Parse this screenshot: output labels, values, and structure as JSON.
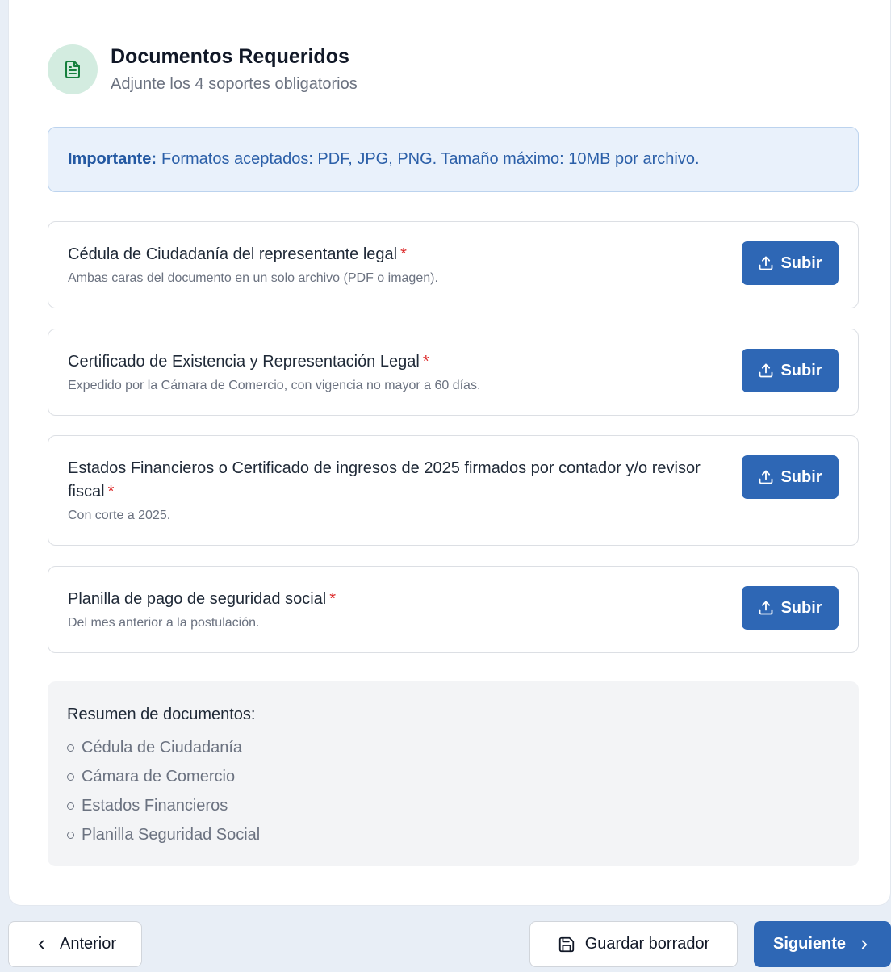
{
  "header": {
    "title": "Documentos Requeridos",
    "subtitle": "Adjunte los 4 soportes obligatorios",
    "icon": "document-icon"
  },
  "notice": {
    "label": "Importante:",
    "text": "Formatos aceptados: PDF, JPG, PNG. Tamaño máximo: 10MB por archivo."
  },
  "documents": [
    {
      "title": "Cédula de Ciudadanía del representante legal",
      "required_mark": "*",
      "description": "Ambas caras del documento en un solo archivo (PDF o imagen).",
      "button_label": "Subir"
    },
    {
      "title": "Certificado de Existencia y Representación Legal",
      "required_mark": "*",
      "description": "Expedido por la Cámara de Comercio, con vigencia no mayor a 60 días.",
      "button_label": "Subir"
    },
    {
      "title": "Estados Financieros o Certificado de ingresos de 2025 firmados por contador y/o revisor fiscal",
      "required_mark": "*",
      "description": "Con corte a 2025.",
      "button_label": "Subir"
    },
    {
      "title": "Planilla de pago de seguridad social",
      "required_mark": "*",
      "description": "Del mes anterior a la postulación.",
      "button_label": "Subir"
    }
  ],
  "summary": {
    "title": "Resumen de documentos:",
    "items": [
      "Cédula de Ciudadanía",
      "Cámara de Comercio",
      "Estados Financieros",
      "Planilla Seguridad Social"
    ]
  },
  "footer": {
    "prev_label": "Anterior",
    "save_label": "Guardar borrador",
    "next_label": "Siguiente"
  },
  "colors": {
    "primary": "#2e67b5",
    "required": "#dc2626",
    "icon_bg": "#d3ece0",
    "icon_fg": "#15803d",
    "notice_bg": "#e9f1fb"
  }
}
